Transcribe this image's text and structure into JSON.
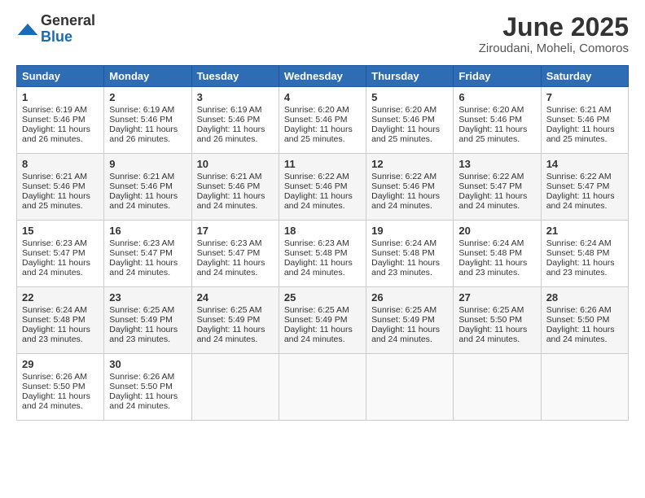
{
  "header": {
    "logo_general": "General",
    "logo_blue": "Blue",
    "month_title": "June 2025",
    "location": "Ziroudani, Moheli, Comoros"
  },
  "weekdays": [
    "Sunday",
    "Monday",
    "Tuesday",
    "Wednesday",
    "Thursday",
    "Friday",
    "Saturday"
  ],
  "rows": [
    [
      {
        "day": "1",
        "lines": [
          "Sunrise: 6:19 AM",
          "Sunset: 5:46 PM",
          "Daylight: 11 hours",
          "and 26 minutes."
        ]
      },
      {
        "day": "2",
        "lines": [
          "Sunrise: 6:19 AM",
          "Sunset: 5:46 PM",
          "Daylight: 11 hours",
          "and 26 minutes."
        ]
      },
      {
        "day": "3",
        "lines": [
          "Sunrise: 6:19 AM",
          "Sunset: 5:46 PM",
          "Daylight: 11 hours",
          "and 26 minutes."
        ]
      },
      {
        "day": "4",
        "lines": [
          "Sunrise: 6:20 AM",
          "Sunset: 5:46 PM",
          "Daylight: 11 hours",
          "and 25 minutes."
        ]
      },
      {
        "day": "5",
        "lines": [
          "Sunrise: 6:20 AM",
          "Sunset: 5:46 PM",
          "Daylight: 11 hours",
          "and 25 minutes."
        ]
      },
      {
        "day": "6",
        "lines": [
          "Sunrise: 6:20 AM",
          "Sunset: 5:46 PM",
          "Daylight: 11 hours",
          "and 25 minutes."
        ]
      },
      {
        "day": "7",
        "lines": [
          "Sunrise: 6:21 AM",
          "Sunset: 5:46 PM",
          "Daylight: 11 hours",
          "and 25 minutes."
        ]
      }
    ],
    [
      {
        "day": "8",
        "lines": [
          "Sunrise: 6:21 AM",
          "Sunset: 5:46 PM",
          "Daylight: 11 hours",
          "and 25 minutes."
        ]
      },
      {
        "day": "9",
        "lines": [
          "Sunrise: 6:21 AM",
          "Sunset: 5:46 PM",
          "Daylight: 11 hours",
          "and 24 minutes."
        ]
      },
      {
        "day": "10",
        "lines": [
          "Sunrise: 6:21 AM",
          "Sunset: 5:46 PM",
          "Daylight: 11 hours",
          "and 24 minutes."
        ]
      },
      {
        "day": "11",
        "lines": [
          "Sunrise: 6:22 AM",
          "Sunset: 5:46 PM",
          "Daylight: 11 hours",
          "and 24 minutes."
        ]
      },
      {
        "day": "12",
        "lines": [
          "Sunrise: 6:22 AM",
          "Sunset: 5:46 PM",
          "Daylight: 11 hours",
          "and 24 minutes."
        ]
      },
      {
        "day": "13",
        "lines": [
          "Sunrise: 6:22 AM",
          "Sunset: 5:47 PM",
          "Daylight: 11 hours",
          "and 24 minutes."
        ]
      },
      {
        "day": "14",
        "lines": [
          "Sunrise: 6:22 AM",
          "Sunset: 5:47 PM",
          "Daylight: 11 hours",
          "and 24 minutes."
        ]
      }
    ],
    [
      {
        "day": "15",
        "lines": [
          "Sunrise: 6:23 AM",
          "Sunset: 5:47 PM",
          "Daylight: 11 hours",
          "and 24 minutes."
        ]
      },
      {
        "day": "16",
        "lines": [
          "Sunrise: 6:23 AM",
          "Sunset: 5:47 PM",
          "Daylight: 11 hours",
          "and 24 minutes."
        ]
      },
      {
        "day": "17",
        "lines": [
          "Sunrise: 6:23 AM",
          "Sunset: 5:47 PM",
          "Daylight: 11 hours",
          "and 24 minutes."
        ]
      },
      {
        "day": "18",
        "lines": [
          "Sunrise: 6:23 AM",
          "Sunset: 5:48 PM",
          "Daylight: 11 hours",
          "and 24 minutes."
        ]
      },
      {
        "day": "19",
        "lines": [
          "Sunrise: 6:24 AM",
          "Sunset: 5:48 PM",
          "Daylight: 11 hours",
          "and 23 minutes."
        ]
      },
      {
        "day": "20",
        "lines": [
          "Sunrise: 6:24 AM",
          "Sunset: 5:48 PM",
          "Daylight: 11 hours",
          "and 23 minutes."
        ]
      },
      {
        "day": "21",
        "lines": [
          "Sunrise: 6:24 AM",
          "Sunset: 5:48 PM",
          "Daylight: 11 hours",
          "and 23 minutes."
        ]
      }
    ],
    [
      {
        "day": "22",
        "lines": [
          "Sunrise: 6:24 AM",
          "Sunset: 5:48 PM",
          "Daylight: 11 hours",
          "and 23 minutes."
        ]
      },
      {
        "day": "23",
        "lines": [
          "Sunrise: 6:25 AM",
          "Sunset: 5:49 PM",
          "Daylight: 11 hours",
          "and 23 minutes."
        ]
      },
      {
        "day": "24",
        "lines": [
          "Sunrise: 6:25 AM",
          "Sunset: 5:49 PM",
          "Daylight: 11 hours",
          "and 24 minutes."
        ]
      },
      {
        "day": "25",
        "lines": [
          "Sunrise: 6:25 AM",
          "Sunset: 5:49 PM",
          "Daylight: 11 hours",
          "and 24 minutes."
        ]
      },
      {
        "day": "26",
        "lines": [
          "Sunrise: 6:25 AM",
          "Sunset: 5:49 PM",
          "Daylight: 11 hours",
          "and 24 minutes."
        ]
      },
      {
        "day": "27",
        "lines": [
          "Sunrise: 6:25 AM",
          "Sunset: 5:50 PM",
          "Daylight: 11 hours",
          "and 24 minutes."
        ]
      },
      {
        "day": "28",
        "lines": [
          "Sunrise: 6:26 AM",
          "Sunset: 5:50 PM",
          "Daylight: 11 hours",
          "and 24 minutes."
        ]
      }
    ],
    [
      {
        "day": "29",
        "lines": [
          "Sunrise: 6:26 AM",
          "Sunset: 5:50 PM",
          "Daylight: 11 hours",
          "and 24 minutes."
        ]
      },
      {
        "day": "30",
        "lines": [
          "Sunrise: 6:26 AM",
          "Sunset: 5:50 PM",
          "Daylight: 11 hours",
          "and 24 minutes."
        ]
      },
      {
        "day": "",
        "lines": []
      },
      {
        "day": "",
        "lines": []
      },
      {
        "day": "",
        "lines": []
      },
      {
        "day": "",
        "lines": []
      },
      {
        "day": "",
        "lines": []
      }
    ]
  ]
}
